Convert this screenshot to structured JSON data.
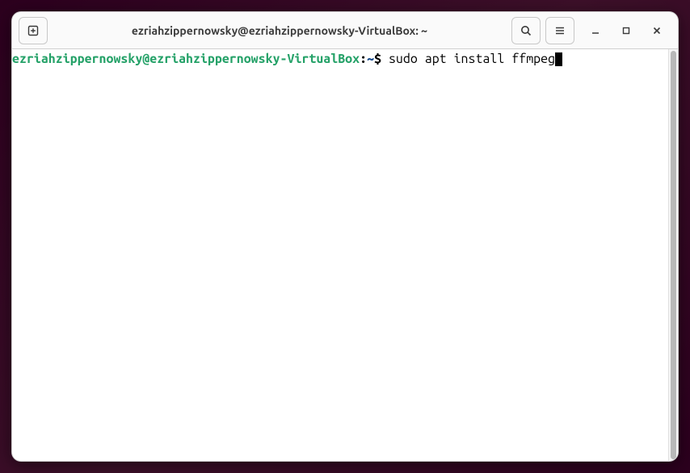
{
  "window": {
    "title": "ezriahzippernowsky@ezriahzippernowsky-VirtualBox: ~"
  },
  "terminal": {
    "prompt_user_host": "ezriahzippernowsky@ezriahzippernowsky-VirtualBox",
    "prompt_sep1": ":",
    "prompt_path": "~",
    "prompt_sep2": "$ ",
    "command": "sudo apt install ffmpeg"
  }
}
